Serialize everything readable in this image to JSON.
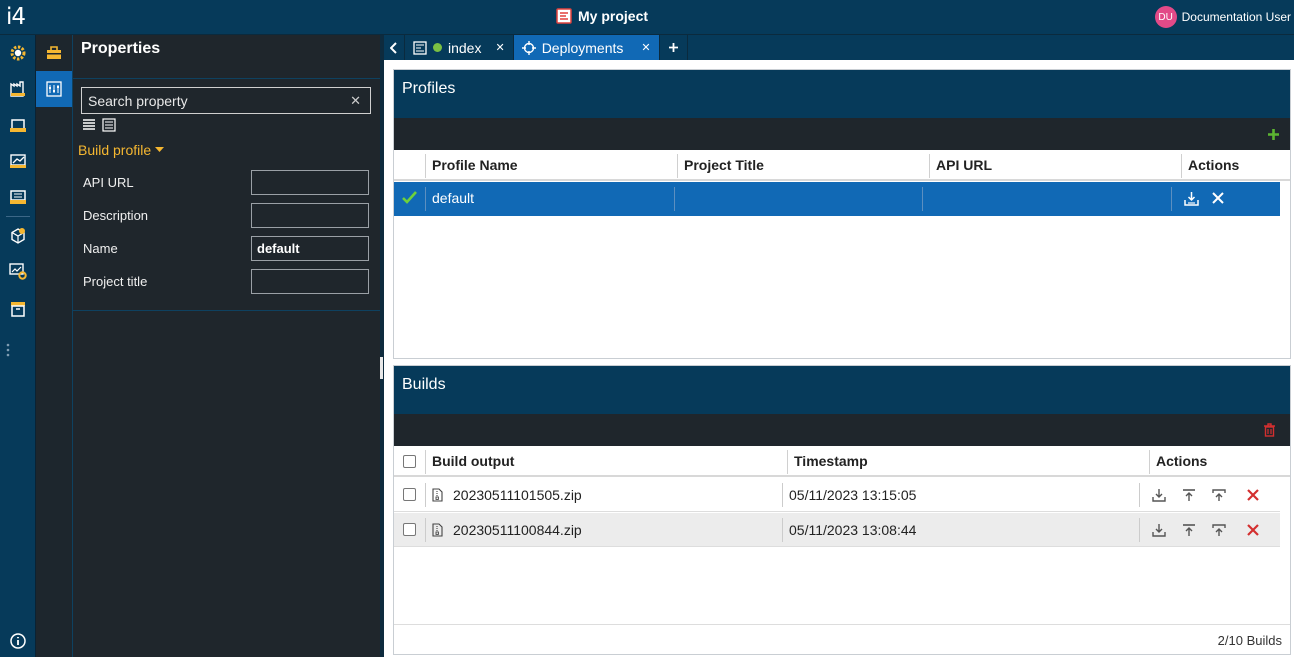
{
  "app": {
    "logo": "i4",
    "project_title": "My project"
  },
  "user": {
    "initials": "DU",
    "name": "Documentation User",
    "avatar_color": "#e24a88"
  },
  "left_rail": {
    "icons": [
      "gear-icon",
      "factory-icon",
      "box-open-icon",
      "chart-box-icon",
      "monitor-icon",
      "cube-upload-icon",
      "chart-gear-icon",
      "archive-icon",
      "more-vertical-icon",
      "info-icon"
    ]
  },
  "sub_rail": {
    "icons": [
      "toolbox-icon",
      "properties-panel-icon"
    ]
  },
  "properties": {
    "title": "Properties",
    "search_placeholder": "Search property",
    "section": "Build profile",
    "fields": [
      {
        "label": "API URL",
        "value": ""
      },
      {
        "label": "Description",
        "value": ""
      },
      {
        "label": "Name",
        "value": "default"
      },
      {
        "label": "Project title",
        "value": ""
      }
    ]
  },
  "tabs": [
    {
      "label": "index",
      "status_color": "#7bc043"
    },
    {
      "label": "Deployments"
    }
  ],
  "profiles": {
    "title": "Profiles",
    "columns": [
      "Profile Name",
      "Project Title",
      "API URL",
      "Actions"
    ],
    "rows": [
      {
        "name": "default",
        "project_title": "",
        "api_url": ""
      }
    ]
  },
  "builds": {
    "title": "Builds",
    "columns": [
      "Build output",
      "Timestamp",
      "Actions"
    ],
    "rows": [
      {
        "file": "20230511101505.zip",
        "timestamp": "05/11/2023 13:15:05"
      },
      {
        "file": "20230511100844.zip",
        "timestamp": "05/11/2023 13:08:44"
      }
    ],
    "footer": "2/10 Builds"
  },
  "colors": {
    "navy": "#063a5a",
    "accent_blue": "#1169b5",
    "orange": "#f5b731",
    "green": "#5cb531",
    "red": "#d32f2f"
  }
}
